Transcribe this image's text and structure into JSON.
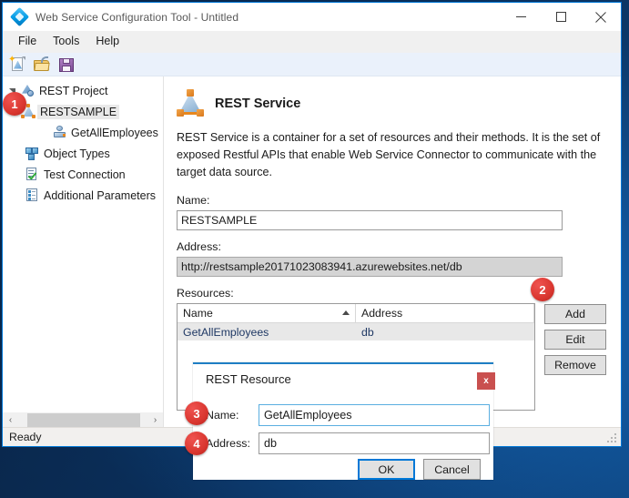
{
  "window": {
    "title": "Web Service Configuration Tool - Untitled",
    "icon": "diamond-app-icon",
    "minimize_label": "─",
    "maximize_label": "☐",
    "close_label": "✕"
  },
  "menubar": {
    "items": [
      {
        "label": "File"
      },
      {
        "label": "Tools"
      },
      {
        "label": "Help"
      }
    ]
  },
  "toolbar": {
    "buttons": [
      {
        "name": "new-project-icon",
        "tip": "New"
      },
      {
        "name": "open-project-icon",
        "tip": "Open"
      },
      {
        "name": "save-project-icon",
        "tip": "Save"
      }
    ]
  },
  "sidebar": {
    "tree": [
      {
        "label": "REST Project",
        "icon": "rest-project-icon",
        "level": 0,
        "expanded": true,
        "selected": false
      },
      {
        "label": "RESTSAMPLE",
        "icon": "rest-service-icon",
        "level": 1,
        "expanded": false,
        "selected": true
      },
      {
        "label": "GetAllEmployees",
        "icon": "rest-resource-icon",
        "level": 2,
        "expanded": false,
        "selected": false
      },
      {
        "label": "Object Types",
        "icon": "object-types-icon",
        "level": 1,
        "expanded": false,
        "selected": false
      },
      {
        "label": "Test Connection",
        "icon": "test-connection-icon",
        "level": 1,
        "expanded": false,
        "selected": false
      },
      {
        "label": "Additional Parameters",
        "icon": "additional-parameters-icon",
        "level": 1,
        "expanded": false,
        "selected": false
      }
    ],
    "hscroll": {
      "left_arrow": "‹",
      "right_arrow": "›"
    }
  },
  "detail": {
    "title": "REST Service",
    "icon": "rest-service-large-icon",
    "description": "REST Service is a container for a set of resources and their methods. It is the set of exposed Restful APIs that enable Web Service Connector to communicate with the target data source.",
    "name_label": "Name:",
    "name_value": "RESTSAMPLE",
    "address_label": "Address:",
    "address_value": "http://restsample20171023083941.azurewebsites.net/db",
    "resources_label": "Resources:",
    "resources_table": {
      "columns": [
        "Name",
        "Address"
      ],
      "sorted_column": "Name",
      "sort_direction": "asc",
      "rows": [
        {
          "name": "GetAllEmployees",
          "address": "db",
          "selected": true
        }
      ]
    },
    "buttons": [
      {
        "label": "Add"
      },
      {
        "label": "Edit"
      },
      {
        "label": "Remove"
      }
    ]
  },
  "statusbar": {
    "text": "Ready"
  },
  "dialog": {
    "title": "REST Resource",
    "close_label": "x",
    "name_label": "Name:",
    "name_value": "GetAllEmployees",
    "name_placeholder": "",
    "address_label": "Address:",
    "address_value": "db",
    "address_placeholder": "",
    "ok_label": "OK",
    "cancel_label": "Cancel"
  },
  "annotations": [
    {
      "number": "1"
    },
    {
      "number": "2"
    },
    {
      "number": "3"
    },
    {
      "number": "4"
    }
  ],
  "colors": {
    "accent": "#0078d7",
    "badge": "#d9362f",
    "dialog_accent": "#1f7ec4",
    "close_button": "#c9504f",
    "link_text": "#1f3864"
  }
}
